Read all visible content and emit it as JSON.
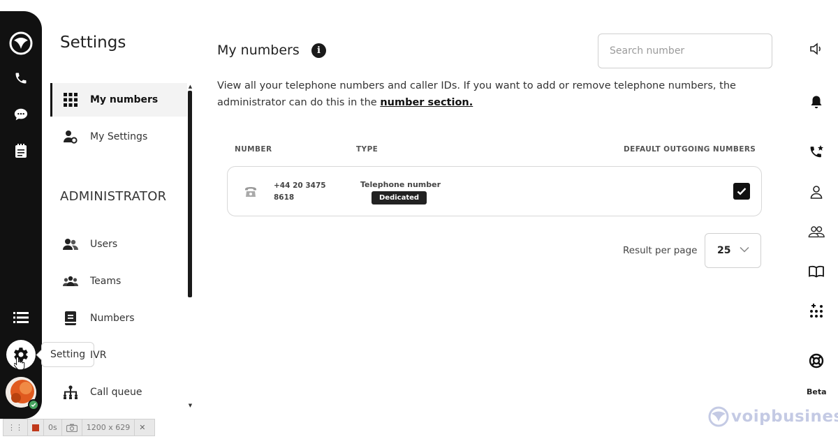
{
  "sidebar_rail": {
    "tooltip": "Setting",
    "icons": [
      "app-logo-icon",
      "phone-icon",
      "chat-icon",
      "notepad-icon",
      "list-icon",
      "gear-icon",
      "avatar"
    ]
  },
  "settings_nav": {
    "title": "Settings",
    "items": [
      {
        "label": "My numbers",
        "icon": "grid-icon",
        "active": true
      },
      {
        "label": "My Settings",
        "icon": "user-gear-icon",
        "active": false
      }
    ],
    "admin_heading": "ADMINISTRATOR",
    "admin_items": [
      {
        "label": "Users",
        "icon": "users-icon"
      },
      {
        "label": "Teams",
        "icon": "teams-icon"
      },
      {
        "label": "Numbers",
        "icon": "numbers-book-icon"
      },
      {
        "label": "IVR",
        "icon": "ivr-icon"
      },
      {
        "label": "Call queue",
        "icon": "call-queue-icon"
      }
    ]
  },
  "main": {
    "title": "My numbers",
    "search_placeholder": "Search number",
    "description": "View all your telephone numbers and caller IDs. If you want to add or remove telephone numbers, the administrator can do this in the",
    "description_link": "number section.",
    "columns": [
      "NUMBER",
      "TYPE",
      "DEFAULT OUTGOING NUMBERS"
    ],
    "rows": [
      {
        "number": "+44 20 3475 8618",
        "type": "Telephone number",
        "badge": "Dedicated",
        "default_outgoing": true
      }
    ],
    "pagination": {
      "label": "Result per page",
      "value": "25"
    }
  },
  "right_bar": {
    "icons": [
      "speaker-icon",
      "bell-icon",
      "phone-star-icon",
      "contact-icon",
      "group-icon",
      "book-icon",
      "dialpad-icon",
      "lifebuoy-icon"
    ],
    "beta_label": "Beta"
  },
  "recorder": {
    "time": "0s",
    "size": "1200 x 629"
  },
  "watermark": "voipbusiness",
  "colors": {
    "rail": "#111111",
    "accent": "#222222",
    "status": "#46a35e",
    "avatar": "#e05a1f"
  }
}
